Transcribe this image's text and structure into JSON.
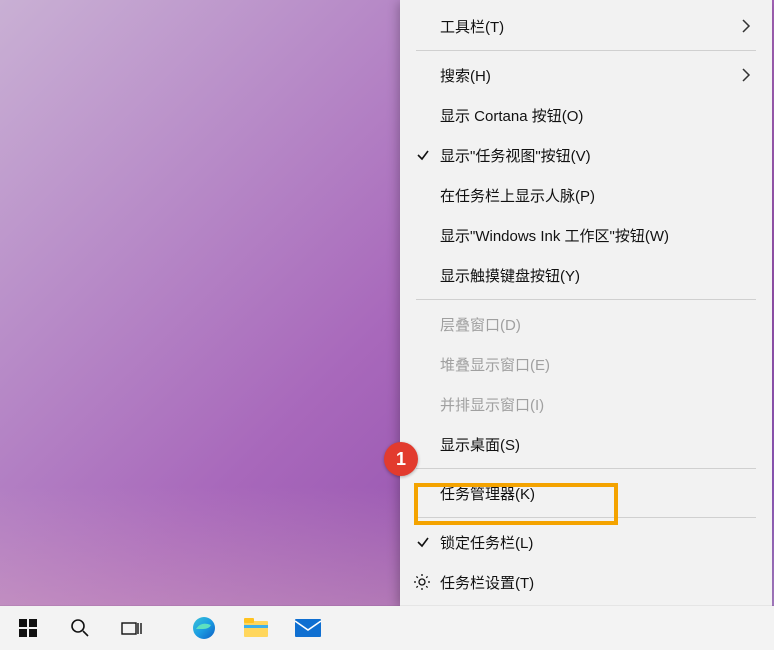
{
  "menu": {
    "toolbar": "工具栏(T)",
    "search": "搜索(H)",
    "show_cortana": "显示 Cortana 按钮(O)",
    "show_taskview": "显示\"任务视图\"按钮(V)",
    "show_people": "在任务栏上显示人脉(P)",
    "show_ink": "显示\"Windows Ink 工作区\"按钮(W)",
    "show_touch_keyboard": "显示触摸键盘按钮(Y)",
    "cascade": "层叠窗口(D)",
    "stacked": "堆叠显示窗口(E)",
    "sidebyside": "并排显示窗口(I)",
    "show_desktop": "显示桌面(S)",
    "task_manager": "任务管理器(K)",
    "lock_taskbar": "锁定任务栏(L)",
    "taskbar_settings": "任务栏设置(T)"
  },
  "annotation": {
    "badge": "1"
  },
  "taskbar": {
    "start": "start",
    "search": "search",
    "taskview": "taskview",
    "edge": "edge",
    "explorer": "explorer",
    "mail": "mail"
  }
}
